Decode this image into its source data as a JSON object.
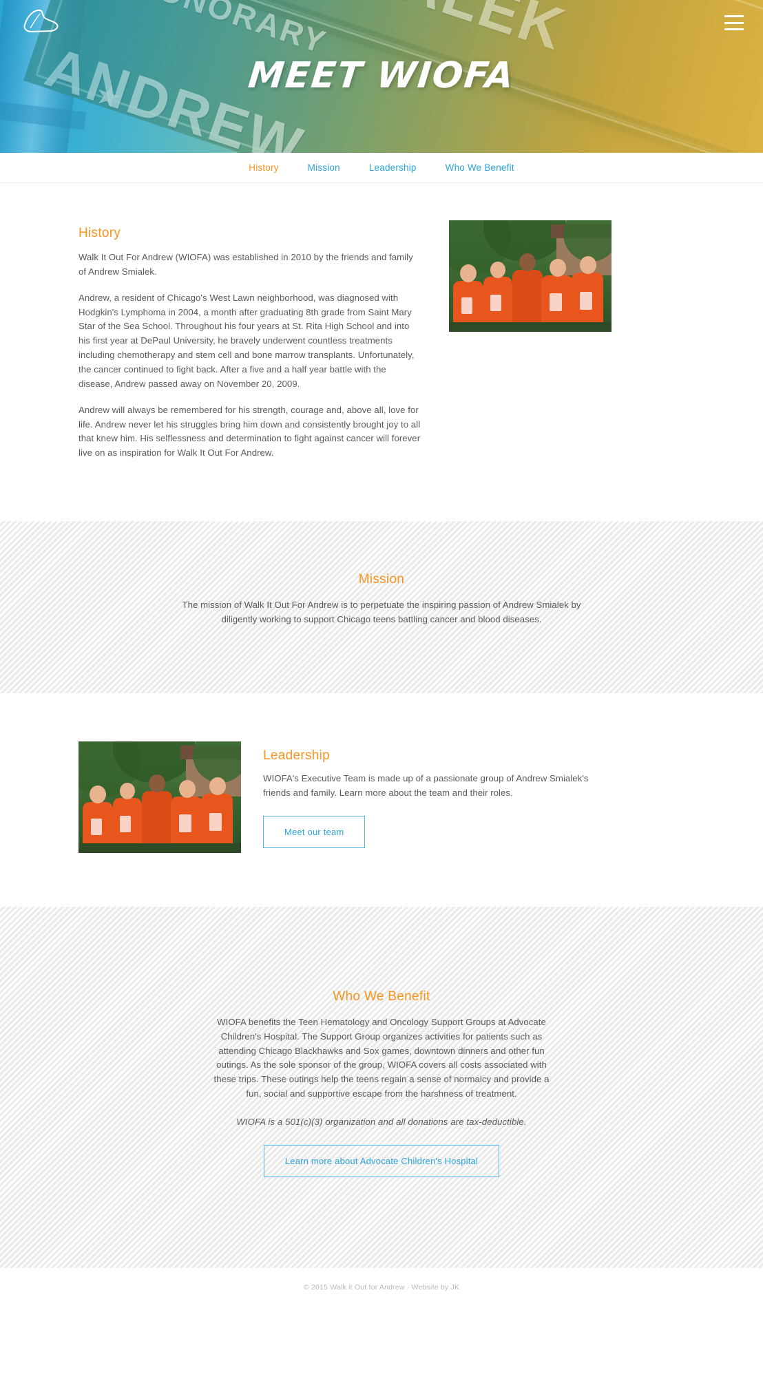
{
  "hero": {
    "title": "MEET WIOFA",
    "logo_icon": "shoe-outline-icon",
    "menu_icon": "hamburger-menu-icon",
    "sign_text_honorary": "HONORARY",
    "sign_text_smialek": "SMIALEK",
    "sign_text_andrew": "ANDREW",
    "sign_text_star": "★"
  },
  "nav": {
    "items": [
      {
        "label": "History",
        "active": true
      },
      {
        "label": "Mission",
        "active": false
      },
      {
        "label": "Leadership",
        "active": false
      },
      {
        "label": "Who We Benefit",
        "active": false
      }
    ]
  },
  "history": {
    "heading": "History",
    "p1": "Walk It Out For Andrew (WIOFA) was established in 2010 by the friends and family of Andrew Smialek.",
    "p2": "Andrew, a resident of Chicago's West Lawn neighborhood, was diagnosed with Hodgkin's Lymphoma in 2004, a month after graduating 8th grade from Saint Mary Star of the Sea School. Throughout his four years at St. Rita High School and into his first year at DePaul University, he bravely underwent countless treatments including chemotherapy and stem cell and bone marrow transplants. Unfortunately, the cancer continued to fight back. After a five and a half year battle with the disease, Andrew passed away on November 20, 2009.",
    "p3": "Andrew will always be remembered for his strength, courage and, above all, love for life. Andrew never let his struggles bring him down and consistently brought joy to all that knew him. His selflessness and determination to fight against cancer will forever live on as inspiration for Walk It Out For Andrew.",
    "photo_alt": "wiofa-team-group-photo"
  },
  "mission": {
    "heading": "Mission",
    "text": "The mission of Walk It Out For Andrew is to perpetuate the inspiring passion of Andrew Smialek by diligently working to support Chicago teens battling cancer and blood diseases."
  },
  "leadership": {
    "heading": "Leadership",
    "text": "WIOFA's Executive Team is made up of a passionate group of Andrew Smialek's friends and family. Learn more about the team and their roles.",
    "button_label": "Meet our team",
    "photo_alt": "wiofa-executive-team-photo"
  },
  "benefit": {
    "heading": "Who We Benefit",
    "text": "WIOFA benefits the Teen Hematology and Oncology Support Groups at Advocate Children's Hospital. The Support Group organizes activities for patients such as attending Chicago Blackhawks and Sox games, downtown dinners and other fun outings. As the sole sponsor of the group, WIOFA covers all costs associated with these trips. These outings help the teens regain a sense of normalcy and provide a fun, social and supportive escape from the harshness of treatment.",
    "note": "WIOFA is a 501(c)(3) organization and all donations are tax-deductible.",
    "button_label": "Learn more about Advocate Children's Hospital"
  },
  "footer": {
    "copyright": "© 2015 Walk it Out for Andrew  ·  Website by JK"
  },
  "colors": {
    "accent_orange": "#f7941e",
    "accent_blue": "#2ba3dd",
    "border_blue": "#4cb9e8",
    "body_text": "#5a5a5a",
    "footer_text": "#b8b8b8"
  }
}
